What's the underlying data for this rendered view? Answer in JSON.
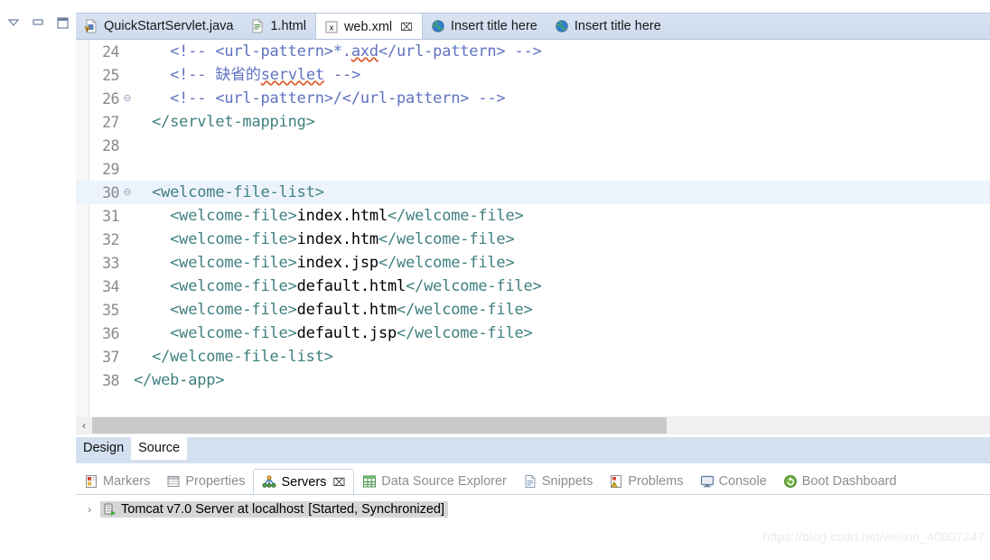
{
  "rail": {
    "controls": [
      {
        "name": "view-menu-icon",
        "label": "View Menu"
      },
      {
        "name": "minimize-icon",
        "label": "Minimize"
      },
      {
        "name": "maximize-icon",
        "label": "Maximize"
      }
    ]
  },
  "editor": {
    "tabs": [
      {
        "label": "QuickStartServlet.java",
        "icon": "java-file-icon",
        "active": false,
        "closable": false
      },
      {
        "label": "1.html",
        "icon": "html-file-icon",
        "active": false,
        "closable": false
      },
      {
        "label": "web.xml",
        "icon": "xml-file-icon",
        "active": true,
        "closable": true,
        "close": "⌧"
      },
      {
        "label": "Insert title here",
        "icon": "globe-icon",
        "active": false,
        "closable": false
      },
      {
        "label": "Insert title here",
        "icon": "globe-icon",
        "active": false,
        "closable": false
      }
    ],
    "lines": [
      {
        "num": "24",
        "fold": "",
        "highlight": false,
        "parts": [
          {
            "cls": "cmt",
            "text": "    <!-- <url-pattern>*."
          },
          {
            "cls": "cmt sq",
            "text": "axd"
          },
          {
            "cls": "cmt",
            "text": "</url-pattern> -->"
          }
        ]
      },
      {
        "num": "25",
        "fold": "",
        "highlight": false,
        "parts": [
          {
            "cls": "cmt",
            "text": "    <!-- 缺省的"
          },
          {
            "cls": "cmt sq",
            "text": "servlet"
          },
          {
            "cls": "cmt",
            "text": " -->"
          }
        ]
      },
      {
        "num": "26",
        "fold": "⊖",
        "highlight": false,
        "parts": [
          {
            "cls": "cmt",
            "text": "    <!-- <url-pattern>/</url-pattern> -->"
          }
        ]
      },
      {
        "num": "27",
        "fold": "",
        "highlight": false,
        "parts": [
          {
            "cls": "tag",
            "text": "  </servlet-mapping>"
          }
        ]
      },
      {
        "num": "28",
        "fold": "",
        "highlight": false,
        "parts": []
      },
      {
        "num": "29",
        "fold": "",
        "highlight": false,
        "parts": []
      },
      {
        "num": "30",
        "fold": "⊖",
        "highlight": true,
        "parts": [
          {
            "cls": "tag",
            "text": "  <welcome-file-list>"
          }
        ]
      },
      {
        "num": "31",
        "fold": "",
        "highlight": false,
        "parts": [
          {
            "cls": "tag",
            "text": "    <welcome-file>"
          },
          {
            "cls": "txt",
            "text": "index.html"
          },
          {
            "cls": "tag",
            "text": "</welcome-file>"
          }
        ]
      },
      {
        "num": "32",
        "fold": "",
        "highlight": false,
        "parts": [
          {
            "cls": "tag",
            "text": "    <welcome-file>"
          },
          {
            "cls": "txt",
            "text": "index.htm"
          },
          {
            "cls": "tag",
            "text": "</welcome-file>"
          }
        ]
      },
      {
        "num": "33",
        "fold": "",
        "highlight": false,
        "parts": [
          {
            "cls": "tag",
            "text": "    <welcome-file>"
          },
          {
            "cls": "txt",
            "text": "index.jsp"
          },
          {
            "cls": "tag",
            "text": "</welcome-file>"
          }
        ]
      },
      {
        "num": "34",
        "fold": "",
        "highlight": false,
        "parts": [
          {
            "cls": "tag",
            "text": "    <welcome-file>"
          },
          {
            "cls": "txt",
            "text": "default.html"
          },
          {
            "cls": "tag",
            "text": "</welcome-file>"
          }
        ]
      },
      {
        "num": "35",
        "fold": "",
        "highlight": false,
        "parts": [
          {
            "cls": "tag",
            "text": "    <welcome-file>"
          },
          {
            "cls": "txt",
            "text": "default.htm"
          },
          {
            "cls": "tag",
            "text": "</welcome-file>"
          }
        ]
      },
      {
        "num": "36",
        "fold": "",
        "highlight": false,
        "parts": [
          {
            "cls": "tag",
            "text": "    <welcome-file>"
          },
          {
            "cls": "txt",
            "text": "default.jsp"
          },
          {
            "cls": "tag",
            "text": "</welcome-file>"
          }
        ]
      },
      {
        "num": "37",
        "fold": "",
        "highlight": false,
        "parts": [
          {
            "cls": "tag",
            "text": "  </welcome-file-list>"
          }
        ]
      },
      {
        "num": "38",
        "fold": "",
        "highlight": false,
        "parts": [
          {
            "cls": "tag",
            "text": "</web-app>"
          }
        ]
      }
    ],
    "hscroll": {
      "left_arrow": "‹"
    },
    "bottom_tabs": [
      {
        "label": "Design",
        "active": false
      },
      {
        "label": "Source",
        "active": true
      }
    ]
  },
  "views": {
    "tabs": [
      {
        "label": "Markers",
        "icon": "markers-icon",
        "active": false,
        "closable": false
      },
      {
        "label": "Properties",
        "icon": "properties-icon",
        "active": false,
        "closable": false
      },
      {
        "label": "Servers",
        "icon": "servers-icon",
        "active": true,
        "closable": true,
        "close": "⌧"
      },
      {
        "label": "Data Source Explorer",
        "icon": "data-source-icon",
        "active": false,
        "closable": false
      },
      {
        "label": "Snippets",
        "icon": "snippets-icon",
        "active": false,
        "closable": false
      },
      {
        "label": "Problems",
        "icon": "problems-icon",
        "active": false,
        "closable": false
      },
      {
        "label": "Console",
        "icon": "console-icon",
        "active": false,
        "closable": false
      },
      {
        "label": "Boot Dashboard",
        "icon": "boot-dashboard-icon",
        "active": false,
        "closable": false
      }
    ],
    "server": {
      "twisty": "›",
      "name": "Tomcat v7.0 Server at localhost",
      "state": "[Started, Synchronized]"
    }
  },
  "watermark": "https://blog.csdn.net/weixin_40807247",
  "colors": {
    "tag": "#3f7f7f",
    "text": "#000000",
    "comment": "#5f72c2",
    "spell_squiggle": "#e05a2b",
    "tabbar_bg": "#d5e0f0",
    "highlight_row": "#edf3fd",
    "change_bar": "#3ba7c4"
  }
}
